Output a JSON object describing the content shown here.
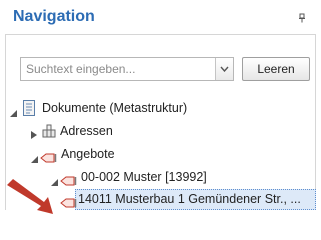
{
  "panel": {
    "title": "Navigation",
    "pin_icon": "pin-icon"
  },
  "search": {
    "placeholder": "Suchtext eingeben...",
    "button_label": "Leeren"
  },
  "tree": {
    "root": {
      "label": "Dokumente (Metastruktur)",
      "icon": "document-icon",
      "expanded": true
    },
    "items": [
      {
        "label": "Adressen",
        "icon": "folder-stack-icon",
        "expanded": false
      },
      {
        "label": "Angebote",
        "icon": "offer-icon",
        "expanded": true
      },
      {
        "label": "00-002 Muster  [13992]",
        "icon": "offer-icon",
        "expanded": true
      },
      {
        "label": "14011 Musterbau 1 Gemündener Str., ...",
        "icon": "offer-icon",
        "selected": true
      }
    ]
  },
  "colors": {
    "title": "#2c6cb4",
    "selection": "#dde9f8",
    "arrow": "#c0392b"
  }
}
